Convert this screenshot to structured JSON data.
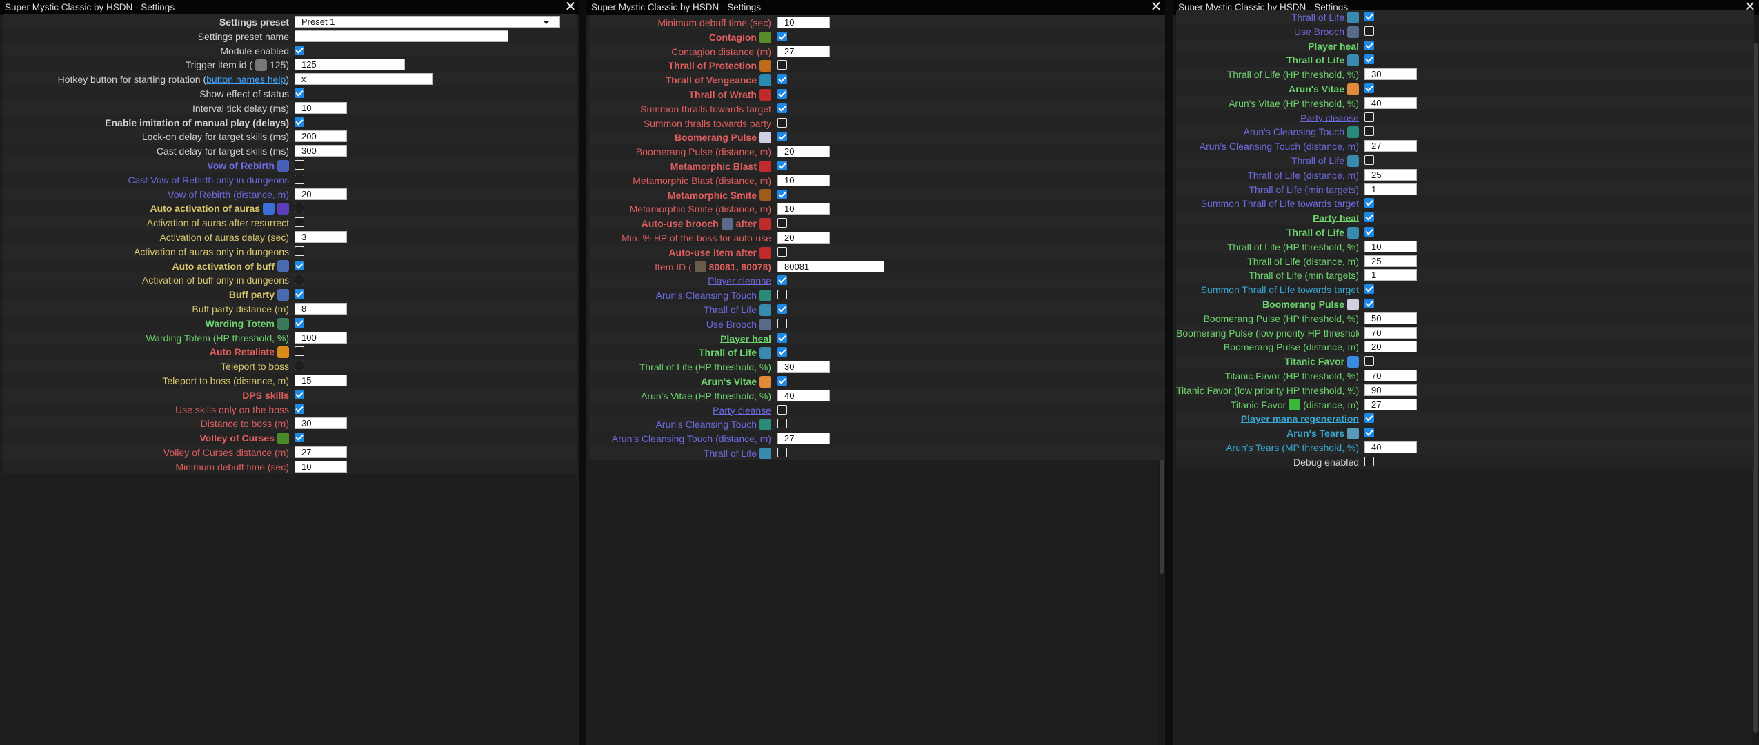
{
  "windows": [
    {
      "title": "Super Mystic Classic by HSDN - Settings",
      "rows": [
        {
          "label": "Settings preset",
          "cls": "c-w b",
          "select": "Preset 1"
        },
        {
          "label": "Settings preset name",
          "cls": "c-w",
          "input": ""
        },
        {
          "label": "Module enabled",
          "cls": "c-w",
          "check": true
        },
        {
          "label": "Trigger item id (",
          "cls": "c-w",
          "suffix": " 125)",
          "icon": "item-icon",
          "icolor": "#777",
          "input": "125"
        },
        {
          "label": "Hotkey button for starting rotation (",
          "cls": "c-w",
          "link": "button names help",
          "suffix": ")",
          "input": "x"
        },
        {
          "label": "Show effect of status",
          "cls": "c-w",
          "check": true
        },
        {
          "label": "Interval tick delay (ms)",
          "cls": "c-w",
          "input": "10"
        },
        {
          "label": "Enable imitation of manual play (delays)",
          "cls": "c-w b",
          "check": true
        },
        {
          "label": "Lock-on delay for target skills (ms)",
          "cls": "c-w",
          "input": "200"
        },
        {
          "label": "Cast delay for target skills (ms)",
          "cls": "c-w",
          "input": "300"
        },
        {
          "label": "Vow of Rebirth",
          "cls": "c-b b",
          "icon": "vow-of-rebirth-icon",
          "icolor": "#4a5fb8",
          "check": false
        },
        {
          "label": "Cast Vow of Rebirth only in dungeons",
          "cls": "c-b",
          "check": false
        },
        {
          "label": "Vow of Rebirth (distance, m)",
          "cls": "c-b",
          "input": "20"
        },
        {
          "label": "Auto activation of auras",
          "cls": "c-y b",
          "icon": "aura-icon",
          "icolor": "#3a6fd8",
          "icon2": "aura-2-icon",
          "icolor2": "#5a3fb8",
          "check": false
        },
        {
          "label": "Activation of auras after resurrect",
          "cls": "c-y",
          "check": false
        },
        {
          "label": "Activation of auras delay (sec)",
          "cls": "c-y",
          "input": "3"
        },
        {
          "label": "Activation of auras only in dungeons",
          "cls": "c-y",
          "check": false
        },
        {
          "label": "Auto activation of buff",
          "cls": "c-y b",
          "icon": "buff-icon",
          "icolor": "#4a6ab0",
          "check": true
        },
        {
          "label": "Activation of buff only in dungeons",
          "cls": "c-y",
          "check": false
        },
        {
          "label": "Buff party",
          "cls": "c-y b",
          "icon": "buff-party-icon",
          "icolor": "#4a6ab0",
          "check": true
        },
        {
          "label": "Buff party distance (m)",
          "cls": "c-y",
          "input": "8"
        },
        {
          "label": "Warding Totem",
          "cls": "c-g b",
          "icon": "warding-totem-icon",
          "icolor": "#3a7a5a",
          "check": true
        },
        {
          "label": "Warding Totem (HP threshold, %)",
          "cls": "c-g",
          "input": "100"
        },
        {
          "label": "Auto Retaliate",
          "cls": "c-r b",
          "icon": "retaliate-icon",
          "icolor": "#d88a1a",
          "check": false
        },
        {
          "label": "Teleport to boss",
          "cls": "c-y",
          "check": false
        },
        {
          "label": "Teleport to boss (distance, m)",
          "cls": "c-y",
          "input": "15"
        },
        {
          "label": "DPS skills",
          "cls": "c-r b u",
          "check": true
        },
        {
          "label": "Use skills only on the boss",
          "cls": "c-r",
          "check": true
        },
        {
          "label": "Distance to boss (m)",
          "cls": "c-r",
          "input": "30"
        },
        {
          "label": "Volley of Curses",
          "cls": "c-r b",
          "icon": "volley-of-curses-icon",
          "icolor": "#4a8a2a",
          "check": true
        },
        {
          "label": "Volley of Curses distance (m)",
          "cls": "c-r",
          "input": "27"
        },
        {
          "label": "Minimum debuff time (sec)",
          "cls": "c-r",
          "input": "10"
        }
      ]
    },
    {
      "title": "Super Mystic Classic by HSDN - Settings",
      "rows": [
        {
          "label": "Minimum debuff time (sec)",
          "cls": "c-r",
          "input": "10"
        },
        {
          "label": "Contagion",
          "cls": "c-r b",
          "icon": "contagion-icon",
          "icolor": "#5a8a2a",
          "check": true
        },
        {
          "label": "Contagion distance (m)",
          "cls": "c-r",
          "input": "27"
        },
        {
          "label": "Thrall of Protection",
          "cls": "c-r b",
          "icon": "thrall-of-protection-icon",
          "icolor": "#c06a1a",
          "check": false
        },
        {
          "label": "Thrall of Vengeance",
          "cls": "c-r b",
          "icon": "thrall-of-vengeance-icon",
          "icolor": "#2a8ab0",
          "check": true
        },
        {
          "label": "Thrall of Wrath",
          "cls": "c-r b",
          "icon": "thrall-of-wrath-icon",
          "icolor": "#c02a2a",
          "check": true
        },
        {
          "label": "Summon thralls towards target",
          "cls": "c-r",
          "check": true
        },
        {
          "label": "Summon thralls towards party",
          "cls": "c-r",
          "check": false
        },
        {
          "label": "Boomerang Pulse",
          "cls": "c-r b",
          "icon": "boomerang-pulse-icon",
          "icolor": "#d0d0e0",
          "check": true
        },
        {
          "label": "Boomerang Pulse (distance, m)",
          "cls": "c-r",
          "input": "20"
        },
        {
          "label": "Metamorphic Blast",
          "cls": "c-r b",
          "icon": "metamorphic-blast-icon",
          "icolor": "#c02a2a",
          "check": true
        },
        {
          "label": "Metamorphic Blast (distance, m)",
          "cls": "c-r",
          "input": "10"
        },
        {
          "label": "Metamorphic Smite",
          "cls": "c-r b",
          "icon": "metamorphic-smite-icon",
          "icolor": "#a05a1a",
          "check": true
        },
        {
          "label": "Metamorphic Smite (distance, m)",
          "cls": "c-r",
          "input": "10"
        },
        {
          "label": "Auto-use brooch",
          "cls": "c-r b",
          "icon": "brooch-icon",
          "icolor": "#5a6a8a",
          "mid": " after",
          "icon2": "metamorphic-icon",
          "icolor2": "#c02a2a",
          "check": false
        },
        {
          "label": "Min. % HP of the boss for auto-use",
          "cls": "c-r",
          "input": "20"
        },
        {
          "label": "Auto-use item after",
          "cls": "c-r b",
          "icon": "auto-use-item-icon",
          "icolor": "#c02a2a",
          "check": false
        },
        {
          "label": "Item ID (",
          "cls": "c-r",
          "icon": "item-id-icon",
          "icolor": "#6a5a4a",
          "suffix": " 80081, 80078)",
          "suffixBold": true,
          "input": "80081",
          "wide": true
        },
        {
          "label": "Player cleanse",
          "cls": "c-b u",
          "check": true
        },
        {
          "label": "Arun's Cleansing Touch",
          "cls": "c-b",
          "icon": "cleansing-touch-icon",
          "icolor": "#2a8a7a",
          "check": false
        },
        {
          "label": "Thrall of Life",
          "cls": "c-b",
          "icon": "thrall-of-life-icon",
          "icolor": "#3a8ab0",
          "check": true
        },
        {
          "label": "Use Brooch",
          "cls": "c-b",
          "icon": "brooch-icon",
          "icolor": "#5a6a8a",
          "check": false
        },
        {
          "label": "Player heal",
          "cls": "c-g b u",
          "check": true
        },
        {
          "label": "Thrall of Life",
          "cls": "c-g b",
          "icon": "thrall-of-life-icon",
          "icolor": "#3a8ab0",
          "check": true
        },
        {
          "label": "Thrall of Life (HP threshold, %)",
          "cls": "c-g",
          "input": "30"
        },
        {
          "label": "Arun's Vitae",
          "cls": "c-g b",
          "icon": "aruns-vitae-icon",
          "icolor": "#e08a3a",
          "check": true
        },
        {
          "label": "Arun's Vitae (HP threshold, %)",
          "cls": "c-g",
          "input": "40"
        },
        {
          "label": "Party cleanse",
          "cls": "c-b u",
          "check": false
        },
        {
          "label": "Arun's Cleansing Touch",
          "cls": "c-b",
          "icon": "cleansing-touch-icon",
          "icolor": "#2a8a7a",
          "check": false
        },
        {
          "label": "Arun's Cleansing Touch (distance, m)",
          "cls": "c-b",
          "input": "27"
        },
        {
          "label": "Thrall of Life",
          "cls": "c-b",
          "icon": "thrall-of-life-icon",
          "icolor": "#3a8ab0",
          "check": false
        }
      ]
    },
    {
      "title": "Super Mystic Classic by HSDN - Settings",
      "rows": [
        {
          "label": "Thrall of Life",
          "cls": "c-b",
          "icon": "thrall-of-life-icon",
          "icolor": "#3a8ab0",
          "check": true
        },
        {
          "label": "Use Brooch",
          "cls": "c-b",
          "icon": "brooch-icon",
          "icolor": "#5a6a8a",
          "check": false
        },
        {
          "label": "Player heal",
          "cls": "c-g b u",
          "check": true
        },
        {
          "label": "Thrall of Life",
          "cls": "c-g b",
          "icon": "thrall-of-life-icon",
          "icolor": "#3a8ab0",
          "check": true
        },
        {
          "label": "Thrall of Life (HP threshold, %)",
          "cls": "c-g",
          "input": "30"
        },
        {
          "label": "Arun's Vitae",
          "cls": "c-g b",
          "icon": "aruns-vitae-icon",
          "icolor": "#e08a3a",
          "check": true
        },
        {
          "label": "Arun's Vitae (HP threshold, %)",
          "cls": "c-g",
          "input": "40"
        },
        {
          "label": "Party cleanse",
          "cls": "c-b u",
          "check": false
        },
        {
          "label": "Arun's Cleansing Touch",
          "cls": "c-b",
          "icon": "cleansing-touch-icon",
          "icolor": "#2a8a7a",
          "check": false
        },
        {
          "label": "Arun's Cleansing Touch (distance, m)",
          "cls": "c-b",
          "input": "27"
        },
        {
          "label": "Thrall of Life",
          "cls": "c-b",
          "icon": "thrall-of-life-icon",
          "icolor": "#3a8ab0",
          "check": false
        },
        {
          "label": "Thrall of Life (distance, m)",
          "cls": "c-b",
          "input": "25"
        },
        {
          "label": "Thrall of Life (min targets)",
          "cls": "c-b",
          "input": "1"
        },
        {
          "label": "Summon Thrall of Life towards target",
          "cls": "c-b",
          "check": true
        },
        {
          "label": "Party heal",
          "cls": "c-g b u",
          "check": true
        },
        {
          "label": "Thrall of Life",
          "cls": "c-g b",
          "icon": "thrall-of-life-icon",
          "icolor": "#3a8ab0",
          "check": true
        },
        {
          "label": "Thrall of Life (HP threshold, %)",
          "cls": "c-g",
          "input": "10"
        },
        {
          "label": "Thrall of Life (distance, m)",
          "cls": "c-g",
          "input": "25"
        },
        {
          "label": "Thrall of Life (min targets)",
          "cls": "c-g",
          "input": "1"
        },
        {
          "label": "Summon Thrall of Life towards target",
          "cls": "c-c",
          "check": true
        },
        {
          "label": "Boomerang Pulse",
          "cls": "c-g b",
          "icon": "boomerang-pulse-icon",
          "icolor": "#d0d0e0",
          "check": true
        },
        {
          "label": "Boomerang Pulse (HP threshold, %)",
          "cls": "c-g",
          "input": "50"
        },
        {
          "label": "Boomerang Pulse (low priority HP threshold, %)",
          "cls": "c-g",
          "input": "70"
        },
        {
          "label": "Boomerang Pulse (distance, m)",
          "cls": "c-g",
          "input": "20"
        },
        {
          "label": "Titanic Favor",
          "cls": "c-g b",
          "icon": "titanic-favor-icon",
          "icolor": "#3a8ae0",
          "check": false
        },
        {
          "label": "Titanic Favor (HP threshold, %)",
          "cls": "c-g",
          "input": "70"
        },
        {
          "label": "Titanic Favor (low priority HP threshold, %)",
          "cls": "c-g",
          "input": "90"
        },
        {
          "label": "Titanic Favor",
          "cls": "c-g",
          "icon": "titanic-favor-orb-icon",
          "icolor": "#3ab83a",
          "suffix": " (distance, m)",
          "input": "27"
        },
        {
          "label": "Player mana regeneration",
          "cls": "c-l b u",
          "check": true
        },
        {
          "label": "Arun's Tears",
          "cls": "c-l b",
          "icon": "aruns-tears-icon",
          "icolor": "#5a9ab8",
          "check": true
        },
        {
          "label": "Arun's Tears (MP threshold, %)",
          "cls": "c-l",
          "input": "40"
        },
        {
          "label": "Debug enabled",
          "cls": "c-w",
          "check": false
        }
      ]
    }
  ]
}
